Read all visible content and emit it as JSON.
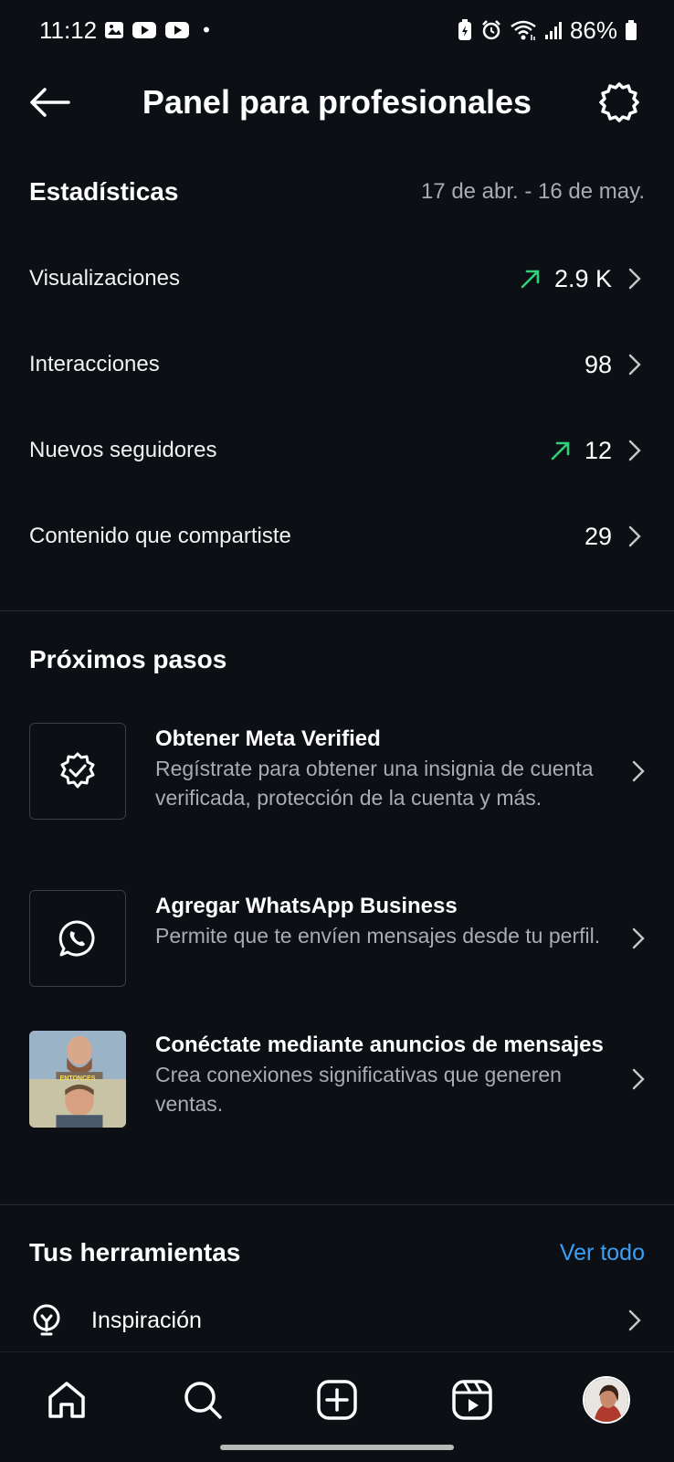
{
  "status_bar": {
    "time": "11:12",
    "dot": "•",
    "battery": "86%"
  },
  "header": {
    "title": "Panel para profesionales"
  },
  "stats": {
    "title": "Estadísticas",
    "date_range": "17 de abr. - 16 de may.",
    "rows": [
      {
        "label": "Visualizaciones",
        "value": "2.9 K",
        "trend_up": true
      },
      {
        "label": "Interacciones",
        "value": "98",
        "trend_up": false
      },
      {
        "label": "Nuevos seguidores",
        "value": "12",
        "trend_up": true
      },
      {
        "label": "Contenido que compartiste",
        "value": "29",
        "trend_up": false
      }
    ]
  },
  "next_steps": {
    "title": "Próximos pasos",
    "items": [
      {
        "title": "Obtener Meta Verified",
        "desc": "Regístrate para obtener una insignia de cuenta verificada, protección de la cuenta y más.",
        "icon": "verified-badge-icon"
      },
      {
        "title": "Agregar WhatsApp Business",
        "desc": "Permite que te envíen mensajes desde tu perfil.",
        "icon": "whatsapp-icon"
      },
      {
        "title": "Conéctate mediante anuncios de mensajes",
        "desc": "Crea conexiones significativas que generen ventas.",
        "icon": "thumbnail-image",
        "thumb_caption": "ENTONCES"
      }
    ]
  },
  "tools": {
    "title": "Tus herramientas",
    "see_all": "Ver todo",
    "items": [
      {
        "label": "Inspiración",
        "icon": "lightbulb-icon"
      }
    ]
  },
  "colors": {
    "background": "#0c0f14",
    "trend_green": "#2fd17a",
    "link_blue": "#3ba0f5",
    "muted_text": "#a8acb3"
  }
}
